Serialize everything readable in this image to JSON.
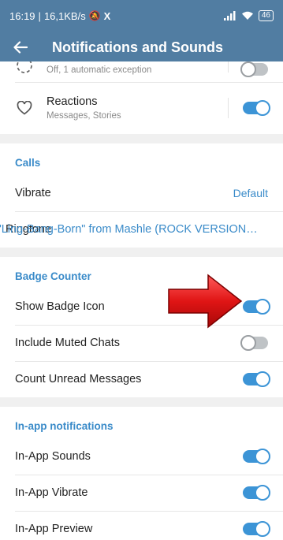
{
  "status_bar": {
    "time": "16:19",
    "speed": "16,1KB/s",
    "battery": "46"
  },
  "toolbar": {
    "title": "Notifications and Sounds"
  },
  "top_partial": {
    "subtitle": "Off, 1 automatic exception",
    "toggle_on": false
  },
  "reactions": {
    "label": "Reactions",
    "subtitle": "Messages, Stories",
    "toggle_on": true
  },
  "calls": {
    "section_title": "Calls",
    "vibrate_label": "Vibrate",
    "vibrate_value": "Default",
    "ringtone_overlay_text": "\"Ling-Bang-Born\" from Mashle (ROCK VERSION…",
    "ringtone_label": "Ringtone"
  },
  "badge": {
    "section_title": "Badge Counter",
    "items": [
      {
        "label": "Show Badge Icon",
        "on": true
      },
      {
        "label": "Include Muted Chats",
        "on": false
      },
      {
        "label": "Count Unread Messages",
        "on": true
      }
    ]
  },
  "inapp": {
    "section_title": "In-app notifications",
    "items": [
      {
        "label": "In-App Sounds",
        "on": true
      },
      {
        "label": "In-App Vibrate",
        "on": true
      },
      {
        "label": "In-App Preview",
        "on": true
      }
    ]
  },
  "annotation": {
    "arrow_color": "#d81e1e"
  }
}
